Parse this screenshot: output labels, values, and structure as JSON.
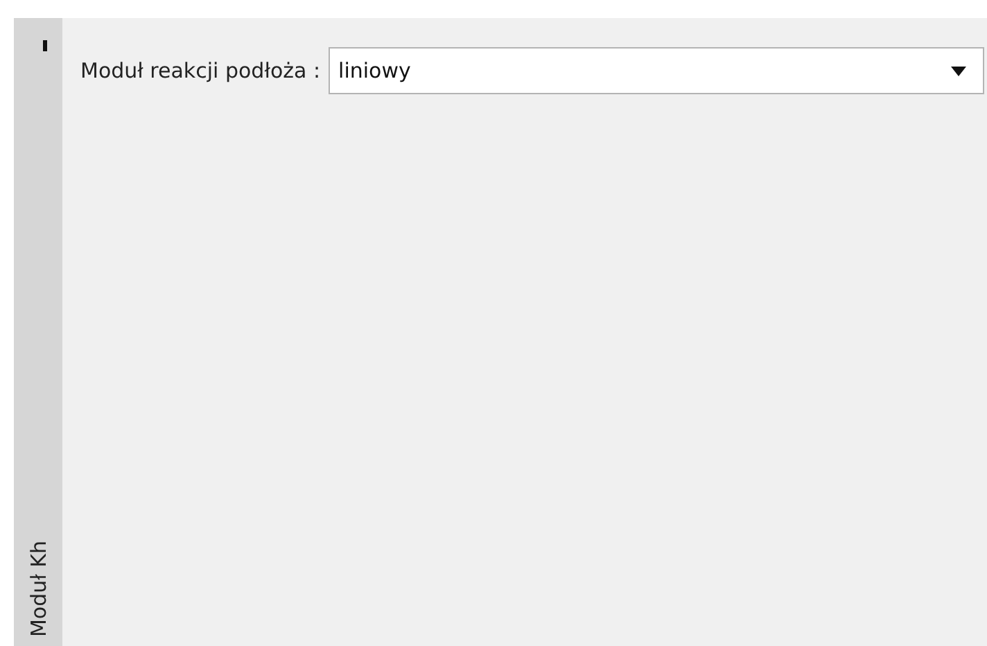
{
  "side_tab": {
    "label": "Moduł Kh"
  },
  "form": {
    "label": "Moduł reakcji podłoża :",
    "select_value": "liniowy"
  }
}
